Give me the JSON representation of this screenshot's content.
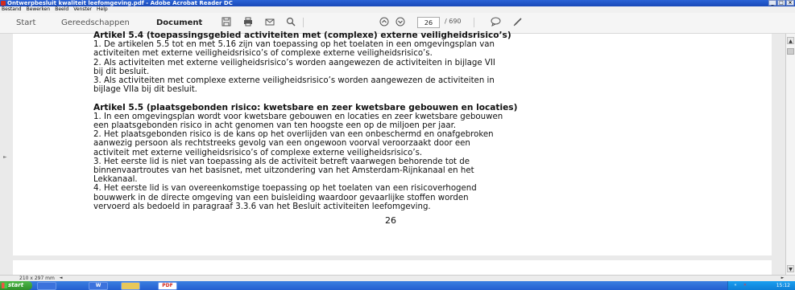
{
  "window": {
    "title": "Ontwerpbesluit kwaliteit leefomgeving.pdf - Adobe Acrobat Reader DC",
    "controls": [
      "_",
      "□",
      "×"
    ]
  },
  "menu": [
    "Bestand",
    "Bewerken",
    "Beeld",
    "Venster",
    "Help"
  ],
  "toolbar": {
    "tabs": [
      "Start",
      "Gereedschappen",
      "Document"
    ],
    "current_page": "26",
    "total_pages": "/ 690"
  },
  "document": {
    "lines": [
      {
        "text": "Artikel 5.4 (toepassingsgebied activiteiten met (complexe) externe veiligheidsrisico’s)",
        "bold": true
      },
      {
        "text": "1. De artikelen 5.5 tot en met 5.16 zijn van toepassing op het toelaten in een omgevingsplan van",
        "bold": false
      },
      {
        "text": "activiteiten met externe veiligheidsrisico’s of complexe externe veiligheidsrisico’s.",
        "bold": false
      },
      {
        "text": "2. Als activiteiten met externe veiligheidsrisico’s worden aangewezen de activiteiten in bijlage VII",
        "bold": false
      },
      {
        "text": "bij dit besluit.",
        "bold": false
      },
      {
        "text": "3. Als activiteiten met complexe externe veiligheidsrisico’s worden aangewezen de activiteiten in",
        "bold": false
      },
      {
        "text": "bijlage VIIa bij dit besluit.",
        "bold": false
      },
      {
        "text": "",
        "bold": false
      },
      {
        "text": "Artikel 5.5 (plaatsgebonden risico: kwetsbare en zeer kwetsbare gebouwen en locaties)",
        "bold": true
      },
      {
        "text": "1. In een omgevingsplan wordt voor kwetsbare gebouwen en locaties en zeer kwetsbare gebouwen",
        "bold": false
      },
      {
        "text": "een plaatsgebonden risico in acht genomen van ten hoogste een op de miljoen per jaar.",
        "bold": false
      },
      {
        "text": "2. Het plaatsgebonden risico is de kans op het overlijden van een onbeschermd en onafgebroken",
        "bold": false
      },
      {
        "text": "aanwezig persoon als rechtstreeks gevolg van een ongewoon voorval veroorzaakt door een",
        "bold": false
      },
      {
        "text": "activiteit met externe veiligheidsrisico’s of complexe externe veiligheidsrisico’s.",
        "bold": false
      },
      {
        "text": "3. Het eerste lid is niet van toepassing als de activiteit betreft vaarwegen behorende tot de",
        "bold": false
      },
      {
        "text": "binnenvaartroutes van het basisnet, met uitzondering van het Amsterdam-Rijnkanaal en het",
        "bold": false
      },
      {
        "text": "Lekkanaal.",
        "bold": false
      },
      {
        "text": "4. Het eerste lid is van overeenkomstige toepassing op het toelaten van een risicoverhogend",
        "bold": false
      },
      {
        "text": "bouwwerk in de directe omgeving van een buisleiding waardoor gevaarlijke stoffen worden",
        "bold": false
      },
      {
        "text": "vervoerd als bedoeld in paragraaf 3.3.6 van het Besluit activiteiten leefomgeving.",
        "bold": false
      }
    ],
    "page_number": "26"
  },
  "status": {
    "page_size": "210 x 297 mm"
  },
  "taskbar": {
    "start_label": "start",
    "apps": [
      "",
      "W",
      "",
      "PDF"
    ],
    "clock": "15:12"
  }
}
